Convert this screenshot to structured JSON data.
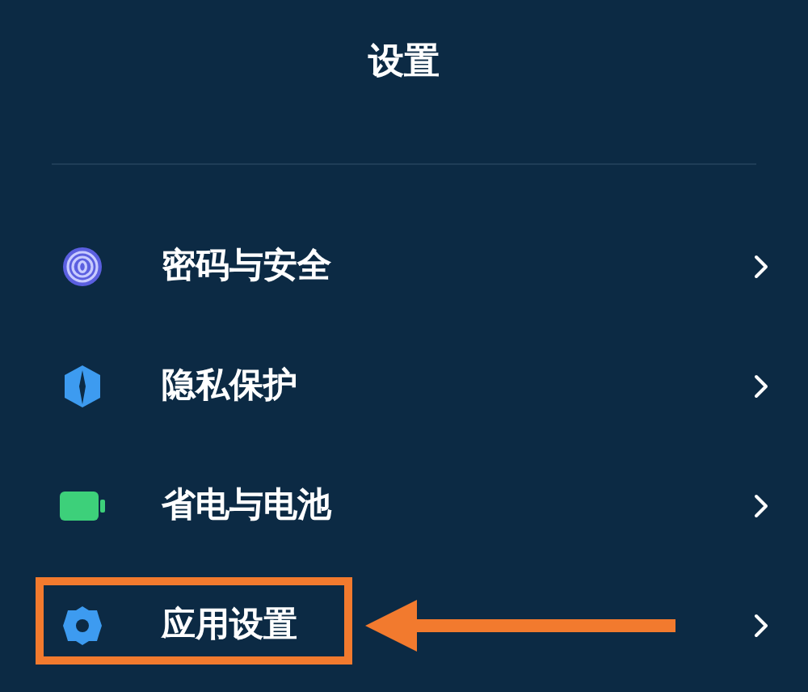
{
  "header": {
    "title": "设置"
  },
  "items": [
    {
      "label": "密码与安全",
      "kind": "fingerprint",
      "highlighted": false
    },
    {
      "label": "隐私保护",
      "kind": "shield",
      "highlighted": false
    },
    {
      "label": "省电与电池",
      "kind": "battery",
      "highlighted": false
    },
    {
      "label": "应用设置",
      "kind": "gear",
      "highlighted": true
    }
  ]
}
